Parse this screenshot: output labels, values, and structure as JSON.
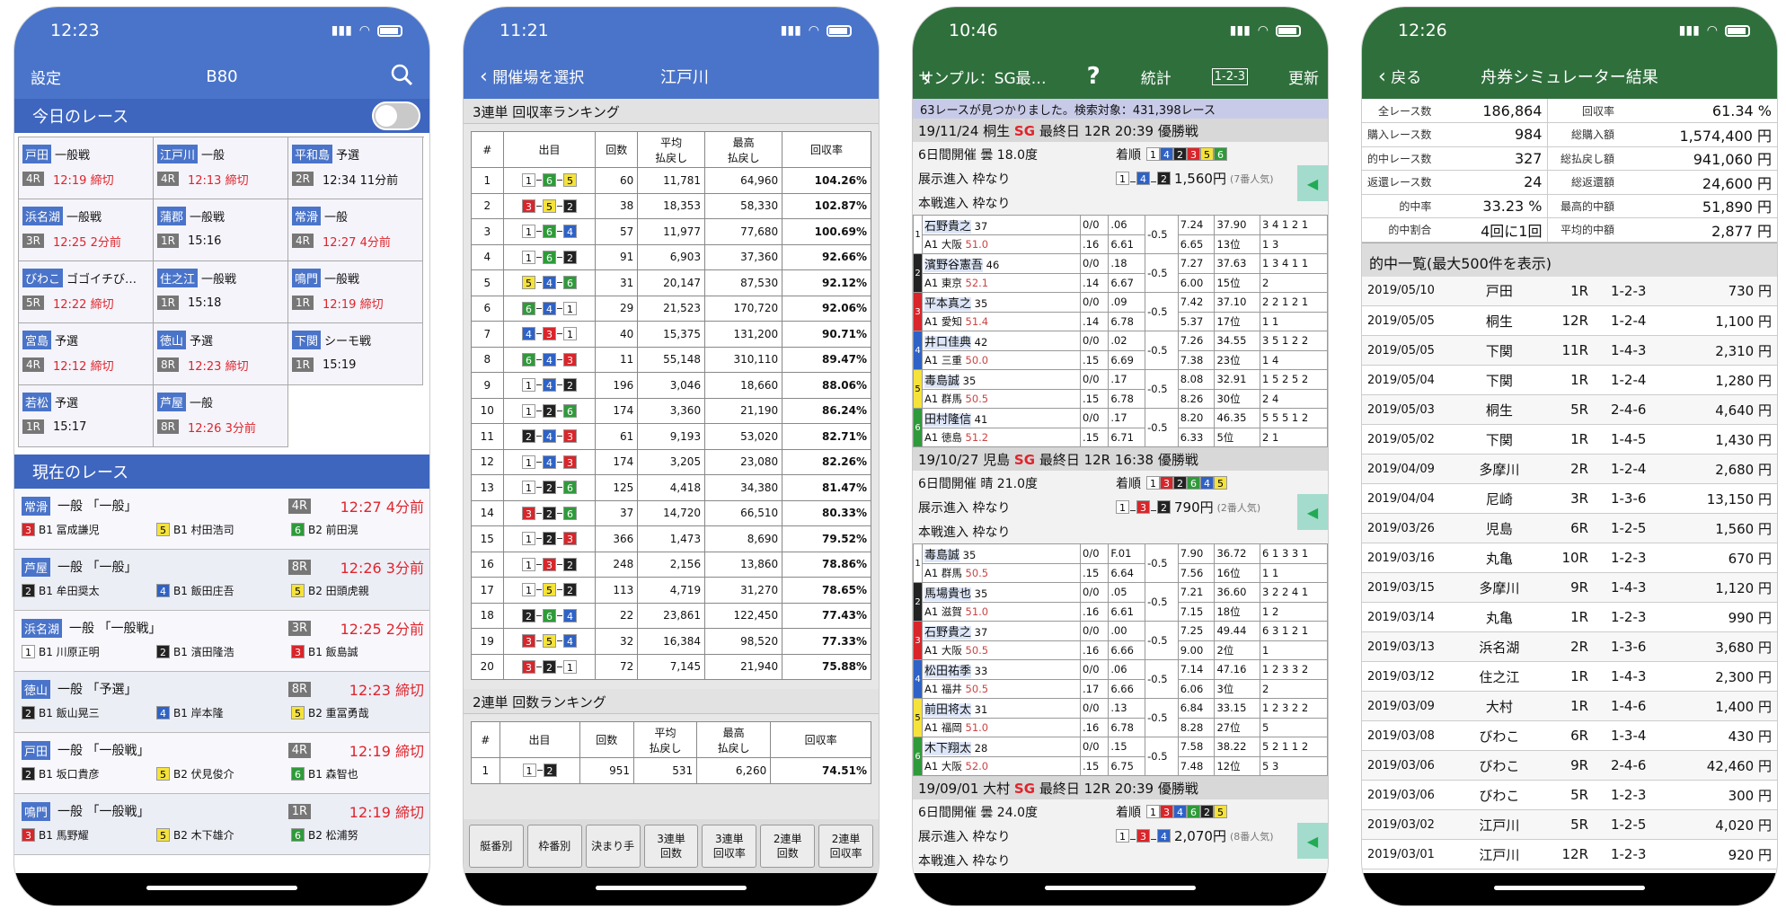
{
  "p1": {
    "time": "12:23",
    "left": "設定",
    "title": "B80",
    "sect_today": "今日のレース",
    "sect_now": "現在のレース",
    "today": [
      {
        "jo": "戸田",
        "cls": "一般戦",
        "r": "4R",
        "t": "12:19 締切",
        "red": true
      },
      {
        "jo": "江戸川",
        "cls": "一般",
        "r": "4R",
        "t": "12:13 締切",
        "red": true
      },
      {
        "jo": "平和島",
        "cls": "予選",
        "r": "2R",
        "t": "12:34 11分前",
        "red": false
      },
      {
        "jo": "浜名湖",
        "cls": "一般戦",
        "r": "3R",
        "t": "12:25 2分前",
        "red": true
      },
      {
        "jo": "蒲郡",
        "cls": "一般戦",
        "r": "1R",
        "t": "15:16",
        "red": false
      },
      {
        "jo": "常滑",
        "cls": "一般",
        "r": "4R",
        "t": "12:27 4分前",
        "red": true
      },
      {
        "jo": "びわこ",
        "cls": "ゴゴイチび…",
        "r": "5R",
        "t": "12:22 締切",
        "red": true
      },
      {
        "jo": "住之江",
        "cls": "一般戦",
        "r": "1R",
        "t": "15:18",
        "red": false
      },
      {
        "jo": "鳴門",
        "cls": "一般戦",
        "r": "1R",
        "t": "12:19 締切",
        "red": true
      },
      {
        "jo": "宮島",
        "cls": "予選",
        "r": "4R",
        "t": "12:12 締切",
        "red": true
      },
      {
        "jo": "徳山",
        "cls": "予選",
        "r": "8R",
        "t": "12:23 締切",
        "red": true
      },
      {
        "jo": "下関",
        "cls": "シーモ戦",
        "r": "1R",
        "t": "15:19",
        "red": false
      },
      {
        "jo": "若松",
        "cls": "予選",
        "r": "1R",
        "t": "15:17",
        "red": false
      },
      {
        "jo": "芦屋",
        "cls": "一般",
        "r": "8R",
        "t": "12:26 3分前",
        "red": true
      }
    ],
    "current": [
      {
        "jo": "常滑",
        "cls": "一般 「一般」",
        "r": "4R",
        "t": "12:27 4分前",
        "ps": [
          [
            "3",
            "B1 冨成謙児"
          ],
          [
            "5",
            "B1 村田浩司"
          ],
          [
            "6",
            "B2 前田滉"
          ]
        ]
      },
      {
        "jo": "芦屋",
        "cls": "一般 「一般」",
        "r": "8R",
        "t": "12:26 3分前",
        "ps": [
          [
            "2",
            "B1 牟田奨太"
          ],
          [
            "4",
            "B1 飯田庄吾"
          ],
          [
            "5",
            "B2 田頭虎親"
          ]
        ]
      },
      {
        "jo": "浜名湖",
        "cls": "一般 「一般戦」",
        "r": "3R",
        "t": "12:25 2分前",
        "ps": [
          [
            "1",
            "B1 川原正明"
          ],
          [
            "2",
            "B1 濱田隆浩"
          ],
          [
            "3",
            "B1 飯島誠"
          ]
        ]
      },
      {
        "jo": "徳山",
        "cls": "一般 「予選」",
        "r": "8R",
        "t": "12:23 締切",
        "ps": [
          [
            "2",
            "B1 飯山晃三"
          ],
          [
            "4",
            "B1 岸本隆"
          ],
          [
            "5",
            "B2 重冨勇哉"
          ]
        ]
      },
      {
        "jo": "戸田",
        "cls": "一般 「一般戦」",
        "r": "4R",
        "t": "12:19 締切",
        "ps": [
          [
            "2",
            "B1 坂口貴彦"
          ],
          [
            "5",
            "B2 伏見俊介"
          ],
          [
            "6",
            "B1 森智也"
          ]
        ]
      },
      {
        "jo": "鳴門",
        "cls": "一般 「一般戦」",
        "r": "1R",
        "t": "12:19 締切",
        "ps": [
          [
            "3",
            "B1 馬野耀"
          ],
          [
            "5",
            "B2 木下雄介"
          ],
          [
            "6",
            "B2 松浦努"
          ]
        ]
      }
    ]
  },
  "p2": {
    "time": "11:21",
    "back": "開催場を選択",
    "title": "江戸川",
    "t1": "3連単 回収率ランキング",
    "t2": "2連単 回数ランキング",
    "h": [
      "#",
      "出目",
      "回数",
      "平均\n払戻し",
      "最高\n払戻し",
      "回収率"
    ],
    "rows": [
      [
        "1",
        "1-6-5",
        "60",
        "11,781",
        "64,960",
        "104.26%"
      ],
      [
        "2",
        "3-5-2",
        "38",
        "18,353",
        "58,330",
        "102.87%"
      ],
      [
        "3",
        "1-6-4",
        "57",
        "11,977",
        "77,680",
        "100.69%"
      ],
      [
        "4",
        "1-6-2",
        "91",
        "6,903",
        "37,360",
        "92.66%"
      ],
      [
        "5",
        "5-4-6",
        "31",
        "20,147",
        "87,530",
        "92.12%"
      ],
      [
        "6",
        "6-4-1",
        "29",
        "21,523",
        "170,720",
        "92.06%"
      ],
      [
        "7",
        "4-3-1",
        "40",
        "15,375",
        "131,200",
        "90.71%"
      ],
      [
        "8",
        "6-4-3",
        "11",
        "55,148",
        "310,110",
        "89.47%"
      ],
      [
        "9",
        "1-4-2",
        "196",
        "3,046",
        "18,660",
        "88.06%"
      ],
      [
        "10",
        "1-2-6",
        "174",
        "3,360",
        "21,190",
        "86.24%"
      ],
      [
        "11",
        "2-4-3",
        "61",
        "9,193",
        "53,020",
        "82.71%"
      ],
      [
        "12",
        "1-4-3",
        "174",
        "3,205",
        "23,080",
        "82.26%"
      ],
      [
        "13",
        "1-2-6",
        "125",
        "4,418",
        "34,380",
        "81.47%"
      ],
      [
        "14",
        "3-2-6",
        "37",
        "14,720",
        "66,510",
        "80.33%"
      ],
      [
        "15",
        "1-2-3",
        "366",
        "1,473",
        "8,690",
        "79.52%"
      ],
      [
        "16",
        "1-3-2",
        "248",
        "2,156",
        "13,860",
        "78.86%"
      ],
      [
        "17",
        "1-5-2",
        "113",
        "4,719",
        "31,270",
        "78.65%"
      ],
      [
        "18",
        "2-6-4",
        "22",
        "23,861",
        "122,450",
        "77.43%"
      ],
      [
        "19",
        "3-5-4",
        "32",
        "16,384",
        "98,520",
        "77.33%"
      ],
      [
        "20",
        "3-2-1",
        "72",
        "7,145",
        "21,940",
        "75.88%"
      ]
    ],
    "r2": [
      "1",
      "1-2",
      "951",
      "531",
      "6,260",
      "74.51%"
    ],
    "tabs": [
      "艇番別",
      "枠番別",
      "決まり手",
      "3連単\n回数",
      "3連単\n回収率",
      "2連単\n回数",
      "2連単\n回収率"
    ]
  },
  "p3": {
    "time": "10:46",
    "title": "サンプル：SG最…",
    "help": "?",
    "stats": "統計",
    "icon123": "1-2-3",
    "update": "更新",
    "found": "63レースが見つかりました。検索対象：431,398レース",
    "races": [
      {
        "head": "19/11/24 桐生",
        "sg": "SG",
        "head2": "最終日 12R 20:39 優勝戦",
        "l1": "6日間開催 曇 18.0度",
        "order_lbl": "着順",
        "order": [
          "1",
          "4",
          "2",
          "3",
          "5",
          "6"
        ],
        "l2": "展示進入 枠なり",
        "res": [
          "1",
          "4",
          "2"
        ],
        "pay": "1,560円",
        "pop": "(7番人気)",
        "l3": "本戦進入 枠なり",
        "racers": [
          [
            "1",
            "石野貴之",
            "37",
            "A1 大阪",
            "51.0",
            "0/0",
            ".06",
            ".16",
            "6.61",
            "-0.5",
            "7.24",
            "6.65",
            "37.90",
            "13位",
            "3 4 1 2 1",
            "1 3"
          ],
          [
            "2",
            "濱野谷憲吾",
            "46",
            "A1 東京",
            "52.1",
            "0/0",
            ".18",
            ".14",
            "6.67",
            "-0.5",
            "7.27",
            "6.00",
            "37.63",
            "15位",
            "1 3 4 1 1",
            "2"
          ],
          [
            "3",
            "平本真之",
            "35",
            "A1 愛知",
            "51.4",
            "0/0",
            ".09",
            ".14",
            "6.78",
            "-0.5",
            "7.42",
            "5.37",
            "37.10",
            "17位",
            "2 2 1 2 1",
            "1 1"
          ],
          [
            "4",
            "井口佳典",
            "42",
            "A1 三重",
            "50.0",
            "0/0",
            ".02",
            ".15",
            "6.69",
            "-0.5",
            "7.26",
            "7.38",
            "34.55",
            "23位",
            "3 5 1 2 2",
            "1 4"
          ],
          [
            "5",
            "毒島誠",
            "35",
            "A1 群馬",
            "50.5",
            "0/0",
            ".17",
            ".15",
            "6.78",
            "-0.5",
            "8.08",
            "8.26",
            "32.91",
            "30位",
            "1 5 2 5 2",
            "2 4"
          ],
          [
            "6",
            "田村隆信",
            "41",
            "A1 徳島",
            "51.2",
            "0/0",
            ".17",
            ".15",
            "6.71",
            "-0.5",
            "8.20",
            "6.33",
            "46.35",
            "5位",
            "5 5 5 1 2",
            "2 1"
          ]
        ]
      },
      {
        "head": "19/10/27 児島",
        "sg": "SG",
        "head2": "最終日 12R 16:38 優勝戦",
        "l1": "6日間開催 晴 21.0度",
        "order_lbl": "着順",
        "order": [
          "1",
          "3",
          "2",
          "6",
          "4",
          "5"
        ],
        "l2": "展示進入 枠なり",
        "res": [
          "1",
          "3",
          "2"
        ],
        "pay": "790円",
        "pop": "(2番人気)",
        "l3": "本戦進入 枠なり",
        "racers": [
          [
            "1",
            "毒島誠",
            "35",
            "A1 群馬",
            "50.5",
            "0/0",
            "F.01",
            ".15",
            "6.64",
            "-0.5",
            "7.90",
            "7.56",
            "36.72",
            "16位",
            "6 1 3 3 1",
            "1 1"
          ],
          [
            "2",
            "馬場貴也",
            "35",
            "A1 滋賀",
            "51.0",
            "0/0",
            ".05",
            ".16",
            "6.61",
            "-0.5",
            "7.21",
            "7.15",
            "36.60",
            "18位",
            "3 2 2 4 1",
            "1 2"
          ],
          [
            "3",
            "石野貴之",
            "37",
            "A1 大阪",
            "50.5",
            "0/0",
            ".00",
            ".16",
            "6.66",
            "-0.5",
            "7.25",
            "9.00",
            "49.44",
            "2位",
            "6 3 1 2 1",
            "1"
          ],
          [
            "4",
            "松田祐季",
            "33",
            "A1 福井",
            "50.5",
            "0/0",
            ".06",
            ".17",
            "6.66",
            "-0.5",
            "7.14",
            "6.06",
            "47.16",
            "3位",
            "1 2 3 3 2",
            "2"
          ],
          [
            "5",
            "前田将太",
            "31",
            "A1 福岡",
            "51.0",
            "0/0",
            ".13",
            ".16",
            "6.78",
            "-0.5",
            "6.84",
            "8.28",
            "33.15",
            "27位",
            "1 2 3 2 2",
            "5"
          ],
          [
            "6",
            "木下翔太",
            "28",
            "A1 大阪",
            "52.0",
            "0/0",
            ".15",
            ".15",
            "6.75",
            "-0.5",
            "7.58",
            "7.48",
            "38.22",
            "12位",
            "5 2 1 1 2",
            "5 3"
          ]
        ]
      },
      {
        "head": "19/09/01 大村",
        "sg": "SG",
        "head2": "最終日 12R 20:39 優勝戦",
        "l1": "6日間開催 曇 24.0度",
        "order_lbl": "着順",
        "order": [
          "1",
          "3",
          "4",
          "6",
          "2",
          "5"
        ],
        "l2": "展示進入 枠なり",
        "res": [
          "1",
          "3",
          "4"
        ],
        "pay": "2,070円",
        "pop": "(8番人気)",
        "l3": "本戦進入 枠なり",
        "racers": []
      }
    ]
  },
  "p4": {
    "time": "12:26",
    "back": "戻る",
    "title": "舟券シミュレーター結果",
    "summary": [
      [
        "全レース数",
        "186,864",
        "回収率",
        "61.34 %"
      ],
      [
        "購入レース数",
        "984",
        "総購入額",
        "1,574,400 円"
      ],
      [
        "的中レース数",
        "327",
        "総払戻し額",
        "941,060 円"
      ],
      [
        "返還レース数",
        "24",
        "総返還額",
        "24,600 円"
      ],
      [
        "的中率",
        "33.23 %",
        "最高的中額",
        "51,890 円"
      ],
      [
        "的中割合",
        "4回に1回",
        "平均的中額",
        "2,877 円"
      ]
    ],
    "list_title": "的中一覧(最大500件を表示)",
    "hits": [
      [
        "2019/05/10",
        "戸田",
        "1R",
        "1-2-3",
        "730 円"
      ],
      [
        "2019/05/05",
        "桐生",
        "12R",
        "1-2-4",
        "1,100 円"
      ],
      [
        "2019/05/05",
        "下関",
        "11R",
        "1-4-3",
        "2,310 円"
      ],
      [
        "2019/05/04",
        "下関",
        "1R",
        "1-2-4",
        "1,280 円"
      ],
      [
        "2019/05/03",
        "桐生",
        "5R",
        "2-4-6",
        "4,640 円"
      ],
      [
        "2019/05/02",
        "下関",
        "1R",
        "1-4-5",
        "1,430 円"
      ],
      [
        "2019/04/09",
        "多摩川",
        "2R",
        "1-2-4",
        "2,680 円"
      ],
      [
        "2019/04/04",
        "尼崎",
        "3R",
        "1-3-6",
        "13,150 円"
      ],
      [
        "2019/03/26",
        "児島",
        "6R",
        "1-2-5",
        "1,560 円"
      ],
      [
        "2019/03/16",
        "丸亀",
        "10R",
        "1-2-3",
        "670 円"
      ],
      [
        "2019/03/15",
        "多摩川",
        "9R",
        "1-4-3",
        "1,120 円"
      ],
      [
        "2019/03/14",
        "丸亀",
        "1R",
        "1-2-3",
        "990 円"
      ],
      [
        "2019/03/13",
        "浜名湖",
        "2R",
        "1-3-6",
        "3,680 円"
      ],
      [
        "2019/03/12",
        "住之江",
        "1R",
        "1-4-3",
        "2,300 円"
      ],
      [
        "2019/03/09",
        "大村",
        "1R",
        "1-4-6",
        "1,400 円"
      ],
      [
        "2019/03/08",
        "びわこ",
        "6R",
        "1-3-4",
        "430 円"
      ],
      [
        "2019/03/06",
        "びわこ",
        "9R",
        "2-4-6",
        "42,460 円"
      ],
      [
        "2019/03/06",
        "びわこ",
        "5R",
        "1-2-3",
        "300 円"
      ],
      [
        "2019/03/02",
        "江戸川",
        "5R",
        "1-2-5",
        "4,020 円"
      ],
      [
        "2019/03/01",
        "江戸川",
        "12R",
        "1-2-3",
        "920 円"
      ]
    ]
  }
}
